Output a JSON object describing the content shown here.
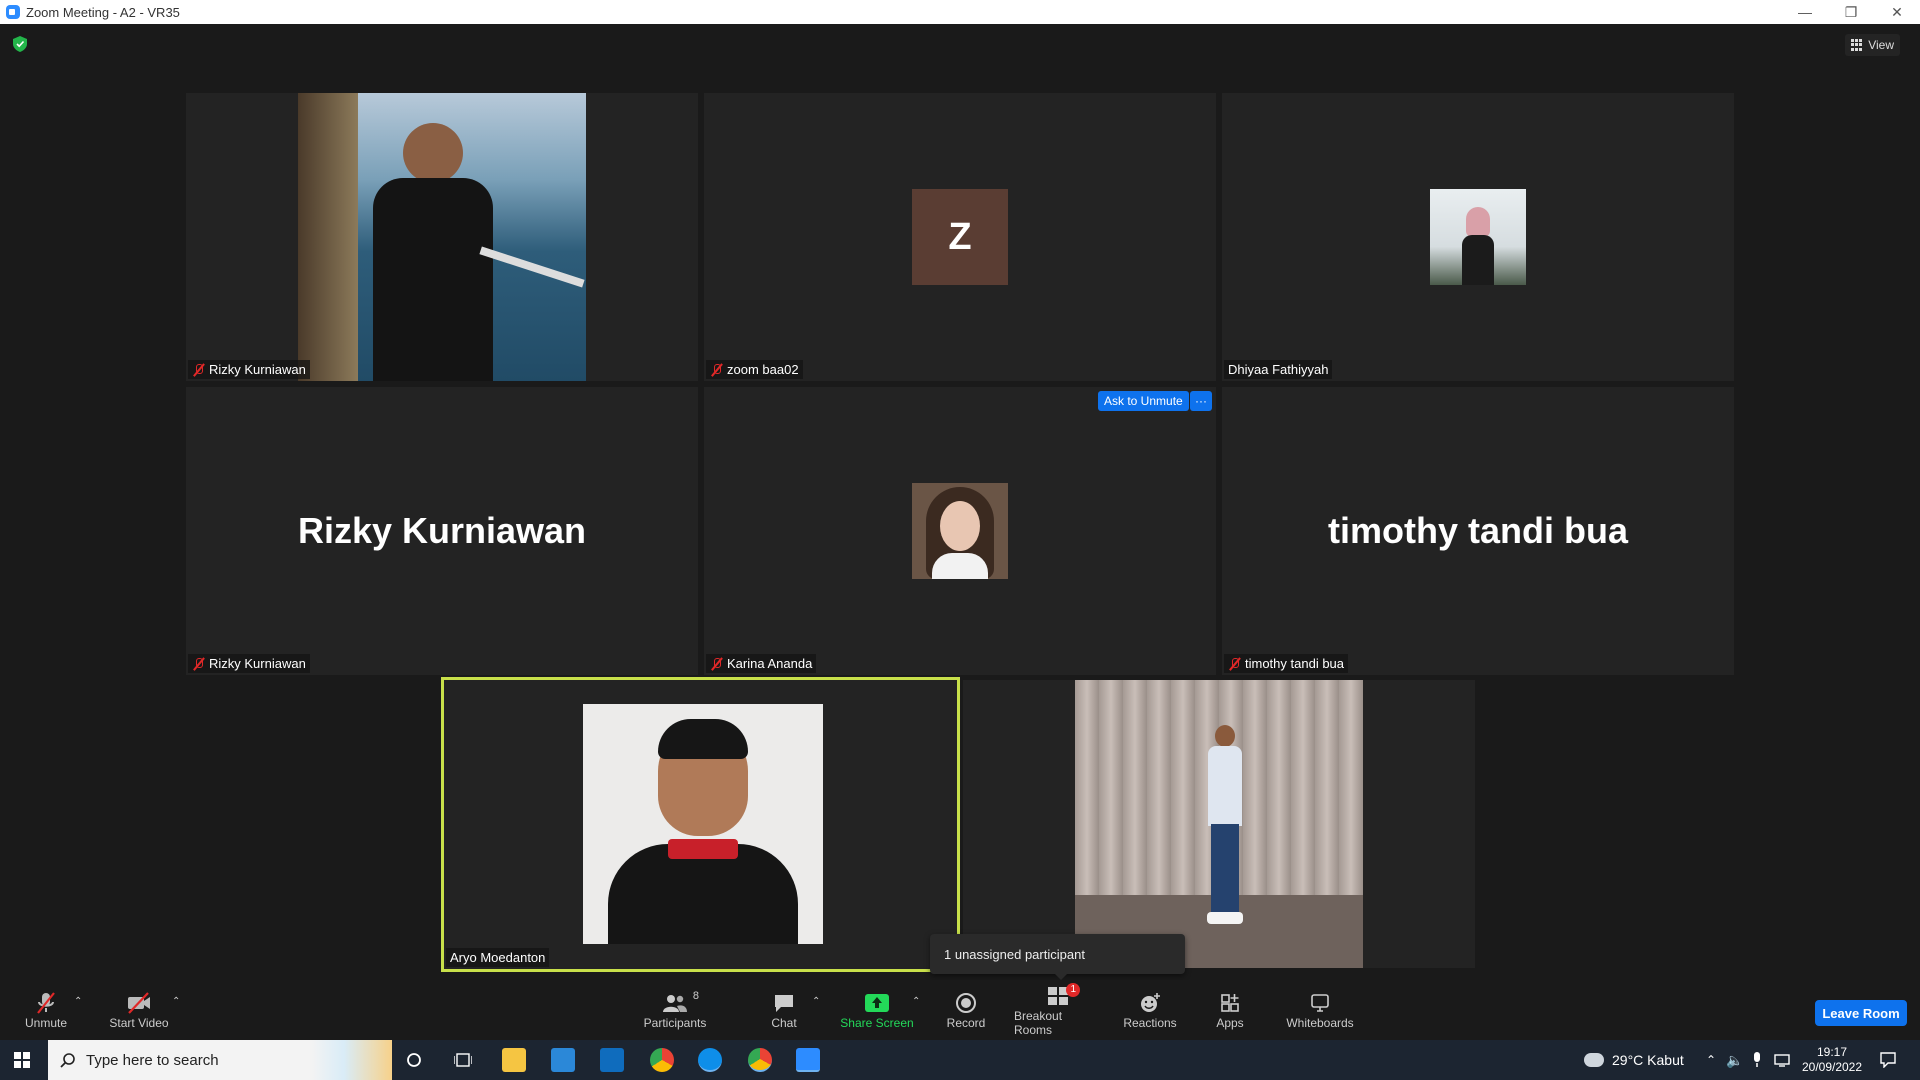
{
  "window": {
    "title": "Zoom Meeting - A2 - VR35"
  },
  "view_button": {
    "label": "View"
  },
  "tiles": [
    {
      "name": "Rizky Kurniawan",
      "muted": true
    },
    {
      "name": "zoom baa02",
      "muted": true,
      "initial": "Z"
    },
    {
      "name": "Dhiyaa Fathiyyah",
      "muted": false
    },
    {
      "name": "Rizky Kurniawan",
      "muted": true,
      "big_label": "Rizky Kurniawan"
    },
    {
      "name": "Karina Ananda",
      "muted": true
    },
    {
      "name": "timothy tandi bua",
      "muted": true,
      "big_label": "timothy tandi bua"
    },
    {
      "name": "Aryo Moedanton",
      "muted": false,
      "active_speaker": true
    },
    {
      "name": "",
      "muted": false
    }
  ],
  "ask_unmute": {
    "label": "Ask to Unmute",
    "more": "···"
  },
  "tooltip": {
    "text": "1 unassigned participant"
  },
  "toolbar": {
    "unmute": "Unmute",
    "start_video": "Start Video",
    "participants": "Participants",
    "participants_count": "8",
    "chat": "Chat",
    "share_screen": "Share Screen",
    "record": "Record",
    "breakout_rooms": "Breakout Rooms",
    "breakout_badge": "1",
    "reactions": "Reactions",
    "apps": "Apps",
    "whiteboards": "Whiteboards",
    "leave": "Leave Room"
  },
  "taskbar": {
    "search_placeholder": "Type here to search",
    "weather": "29°C  Kabut",
    "time": "19:17",
    "date": "20/09/2022"
  },
  "colors": {
    "accent_blue": "#0e72ed",
    "share_green": "#23d959",
    "active_border": "#c8e04a",
    "mute_red": "#e02828",
    "avatar_z_bg": "#5a3d33"
  }
}
